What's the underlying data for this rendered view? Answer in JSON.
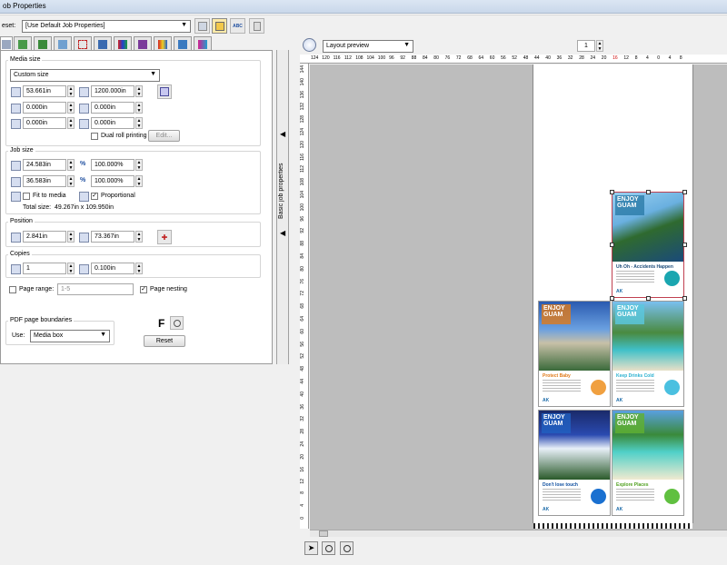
{
  "window": {
    "title": "ob Properties"
  },
  "preset": {
    "label": "eset:",
    "value": "[Use Default Job Properties]"
  },
  "toolbar": {
    "abc_label": "ABC"
  },
  "media_size": {
    "group_label": "Media size",
    "type": "Custom size",
    "width": "53.661in",
    "height": "1200.000in",
    "margin_left": "0.000in",
    "margin_right": "0.000in",
    "margin_top": "0.000in",
    "margin_bottom": "0.000in",
    "dual_roll_label": "Dual roll printing",
    "edit_label": "Edit..."
  },
  "job_size": {
    "group_label": "Job size",
    "width": "24.583in",
    "height": "36.583in",
    "scale_x": "100.000%",
    "scale_y": "100.000%",
    "percent_symbol": "%",
    "fit_label": "Fit to media",
    "proportional_label": "Proportional",
    "total_label": "Total size:",
    "total_value": "49.267in x 109.950in"
  },
  "position": {
    "group_label": "Position",
    "x": "2.841in",
    "y": "73.367in"
  },
  "copies": {
    "group_label": "Copies",
    "count": "1",
    "gap": "0.100in"
  },
  "pages": {
    "range_label": "Page range:",
    "range_value": "1-5",
    "nesting_label": "Page nesting"
  },
  "pdf": {
    "group_label": "PDF page boundaries",
    "use_label": "Use:",
    "use_value": "Media box",
    "f_label": "F",
    "reset_label": "Reset"
  },
  "sidebar": {
    "label": "Basic job properties"
  },
  "preview": {
    "mode": "Layout preview",
    "page": "1"
  },
  "ruler_h": [
    "124",
    "120",
    "116",
    "112",
    "108",
    "104",
    "100",
    "96",
    "92",
    "88",
    "84",
    "80",
    "76",
    "72",
    "68",
    "64",
    "60",
    "56",
    "52",
    "48",
    "44",
    "40",
    "36",
    "32",
    "28",
    "24",
    "20",
    "16",
    "12",
    "8",
    "4",
    "0",
    "4",
    "8"
  ],
  "ruler_v": [
    "144",
    "140",
    "136",
    "132",
    "128",
    "124",
    "120",
    "116",
    "112",
    "108",
    "104",
    "100",
    "96",
    "92",
    "88",
    "84",
    "80",
    "76",
    "72",
    "68",
    "64",
    "60",
    "56",
    "52",
    "48",
    "44",
    "40",
    "36",
    "32",
    "28",
    "24",
    "20",
    "16",
    "12",
    "8",
    "4",
    "0"
  ],
  "tiles": [
    {
      "brand_line1": "ENJOY",
      "brand_line2": "GUAM",
      "heading": "Uh Oh - Accidents Happen",
      "footer": "AK",
      "badge_color": "#2a7aa8",
      "head_color": "#1a4a78",
      "logo_color": "#1aa6b0"
    },
    {
      "brand_line1": "ENJOY",
      "brand_line2": "GUAM",
      "heading": "Protect Baby",
      "footer": "AK",
      "badge_color": "#e07a1a",
      "head_color": "#e07a1a",
      "logo_color": "#f0a040"
    },
    {
      "brand_line1": "ENJOY",
      "brand_line2": "GUAM",
      "heading": "Keep Drinks Cold",
      "footer": "AK",
      "badge_color": "#5ac8e0",
      "head_color": "#2ab0d0",
      "logo_color": "#4ac0e0"
    },
    {
      "brand_line1": "ENJOY",
      "brand_line2": "GUAM",
      "heading": "Don't lose touch",
      "footer": "AK",
      "badge_color": "#2060c0",
      "head_color": "#1050a0",
      "logo_color": "#1a70d0"
    },
    {
      "brand_line1": "ENJOY",
      "brand_line2": "GUAM",
      "heading": "Explore Places",
      "footer": "AK",
      "badge_color": "#60b030",
      "head_color": "#50a020",
      "logo_color": "#60c040"
    }
  ]
}
